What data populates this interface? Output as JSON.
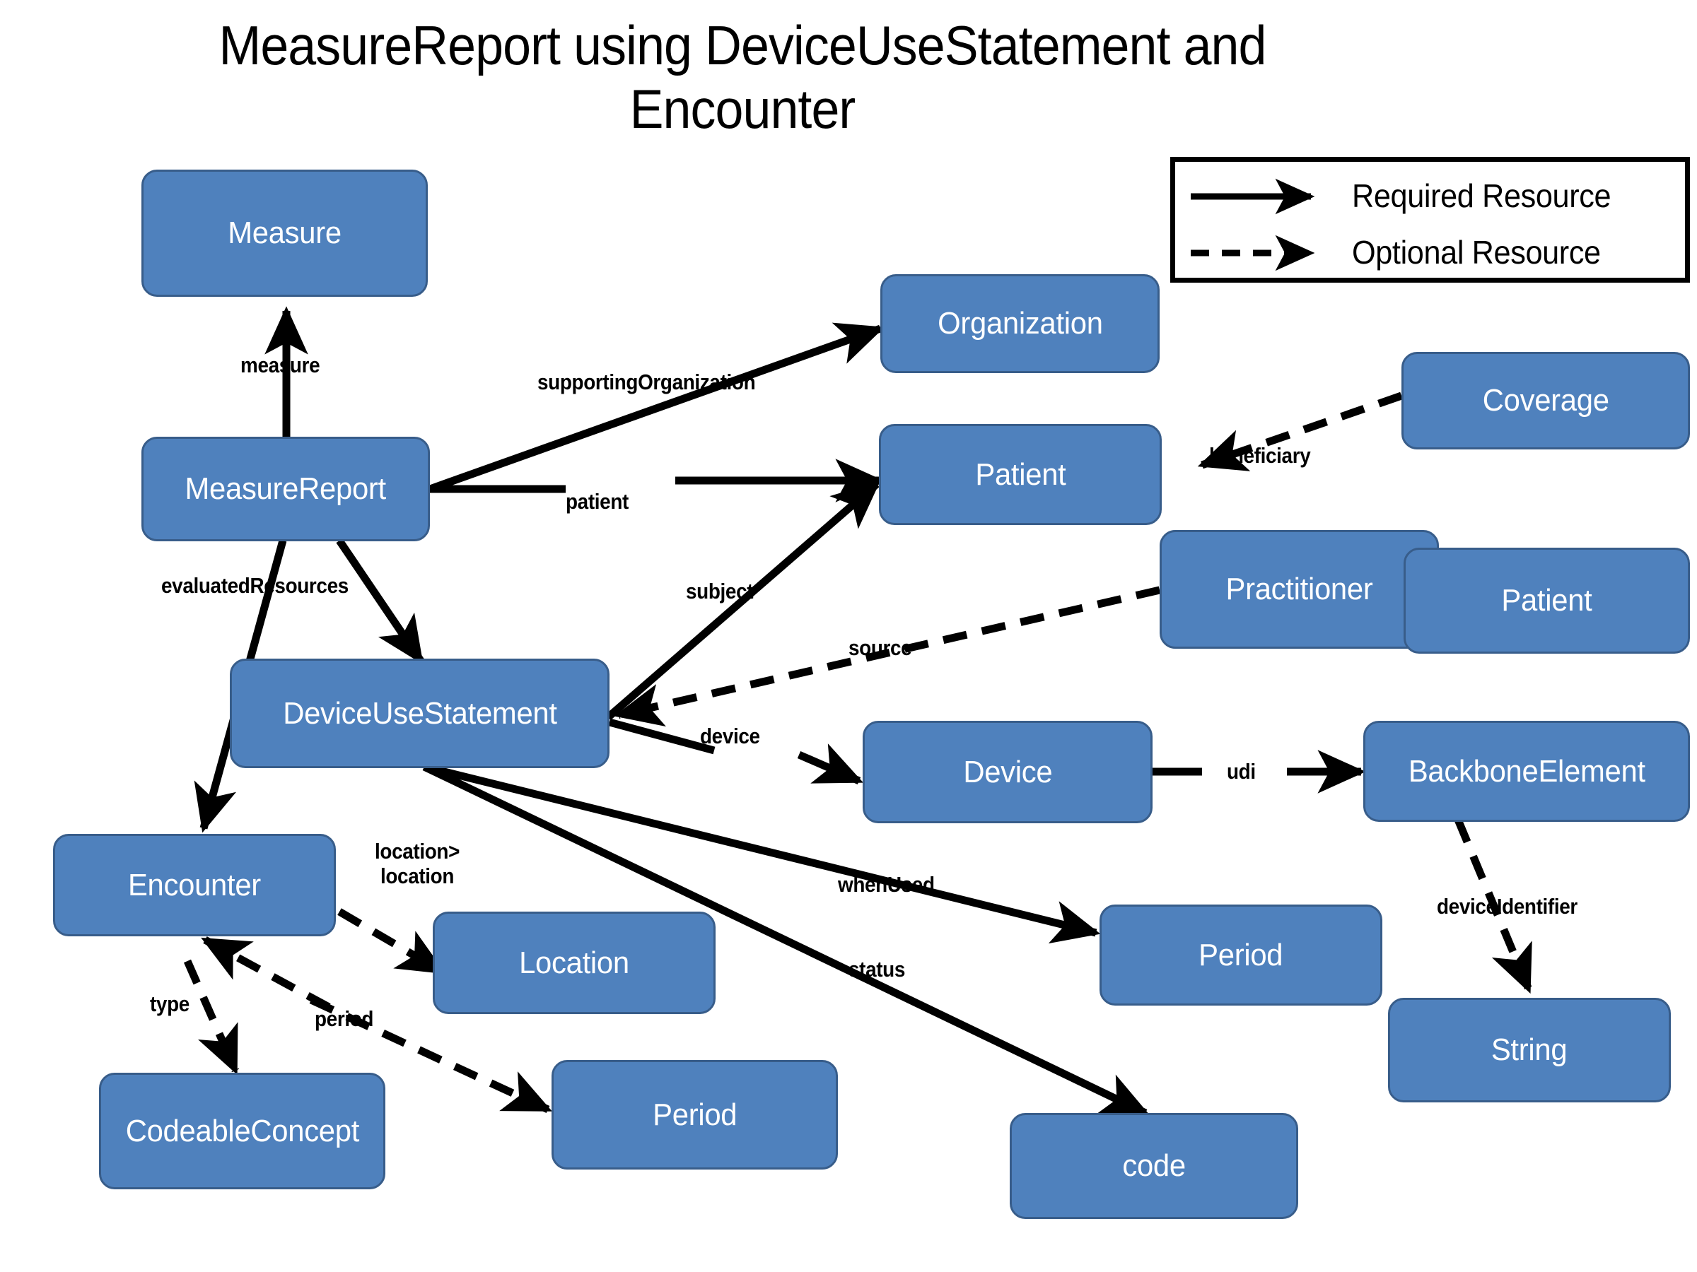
{
  "title": "MeasureReport using DeviceUseStatement and\nEncounter",
  "colors": {
    "node_fill": "#4f81bd",
    "node_border": "#385d8a",
    "node_text": "#ffffff",
    "edge": "#000000",
    "background": "#ffffff"
  },
  "legend": {
    "rows": [
      {
        "label": "Required Resource",
        "style": "solid",
        "icon": "solid-arrow-icon"
      },
      {
        "label": "Optional Resource",
        "style": "dashed",
        "icon": "dashed-arrow-icon"
      }
    ]
  },
  "nodes": [
    {
      "id": "measure",
      "label": "Measure"
    },
    {
      "id": "measurereport",
      "label": "MeasureReport"
    },
    {
      "id": "organization",
      "label": "Organization"
    },
    {
      "id": "patient",
      "label": "Patient"
    },
    {
      "id": "coverage",
      "label": "Coverage"
    },
    {
      "id": "practitioner",
      "label": "Practitioner"
    },
    {
      "id": "patient2",
      "label": "Patient"
    },
    {
      "id": "deviceusestatement",
      "label": "DeviceUseStatement"
    },
    {
      "id": "device",
      "label": "Device"
    },
    {
      "id": "backboneelement",
      "label": "BackboneElement"
    },
    {
      "id": "encounter",
      "label": "Encounter"
    },
    {
      "id": "period_top",
      "label": "Period"
    },
    {
      "id": "string",
      "label": "String"
    },
    {
      "id": "location",
      "label": "Location"
    },
    {
      "id": "codeableconcept",
      "label": "CodeableConcept"
    },
    {
      "id": "period_bottom",
      "label": "Period"
    },
    {
      "id": "code",
      "label": "code"
    }
  ],
  "edges": [
    {
      "id": "measure",
      "label": "measure",
      "from": "measurereport",
      "to": "measure",
      "style": "solid"
    },
    {
      "id": "supportingOrganization",
      "label": "supportingOrganization",
      "from": "measurereport",
      "to": "organization",
      "style": "solid"
    },
    {
      "id": "patient",
      "label": "patient",
      "from": "measurereport",
      "to": "patient",
      "style": "solid"
    },
    {
      "id": "evaluatedResources",
      "label": "evaluatedResources",
      "from": "measurereport",
      "to": "encounter, deviceusestatement",
      "style": "solid"
    },
    {
      "id": "beneficiary",
      "label": "beneficiary",
      "from": "coverage",
      "to": "patient",
      "style": "dashed"
    },
    {
      "id": "subject",
      "label": "subject",
      "from": "deviceusestatement",
      "to": "patient",
      "style": "solid"
    },
    {
      "id": "source",
      "label": "source",
      "from": "deviceusestatement",
      "to": "practitioner",
      "style": "dashed"
    },
    {
      "id": "device",
      "label": "device",
      "from": "deviceusestatement",
      "to": "device",
      "style": "solid"
    },
    {
      "id": "udi",
      "label": "udi",
      "from": "device",
      "to": "backboneelement",
      "style": "solid"
    },
    {
      "id": "deviceIdentifier",
      "label": "deviceIdentifier",
      "from": "backboneelement",
      "to": "string",
      "style": "dashed"
    },
    {
      "id": "whenUsed",
      "label": "whenUsed",
      "from": "deviceusestatement",
      "to": "period_top",
      "style": "solid"
    },
    {
      "id": "status",
      "label": "status",
      "from": "deviceusestatement",
      "to": "code",
      "style": "solid"
    },
    {
      "id": "location",
      "label": "location>\nlocation",
      "from": "encounter",
      "to": "location",
      "style": "dashed"
    },
    {
      "id": "type",
      "label": "type",
      "from": "encounter",
      "to": "codeableconcept",
      "style": "dashed"
    },
    {
      "id": "period",
      "label": "period",
      "from": "encounter",
      "to": "period_bottom",
      "style": "dashed"
    }
  ]
}
